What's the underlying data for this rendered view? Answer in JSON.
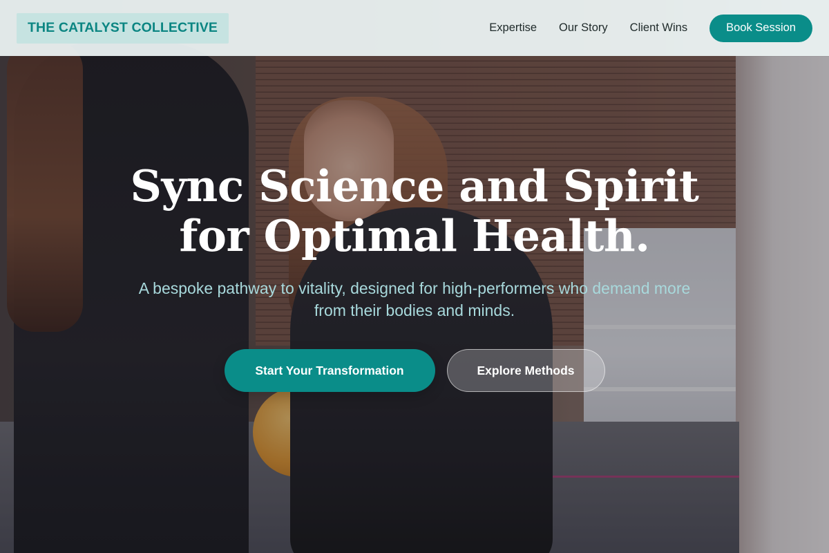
{
  "header": {
    "brand": "THE CATALYST COLLECTIVE",
    "nav": [
      "Expertise",
      "Our Story",
      "Client Wins"
    ],
    "cta": "Book Session"
  },
  "hero": {
    "title_line1": "Sync Science and Spirit",
    "title_line2": "for Optimal Health.",
    "subtitle": "A bespoke pathway to vitality, designed for high-performers who demand more from their bodies and minds.",
    "primary_button": "Start Your Transformation",
    "secondary_button": "Explore Methods"
  },
  "colors": {
    "accent": "#0a8d89",
    "brand_bg": "#c6e3e1",
    "subtitle": "#a8d9dc",
    "header_bg": "#ecf3f3"
  }
}
